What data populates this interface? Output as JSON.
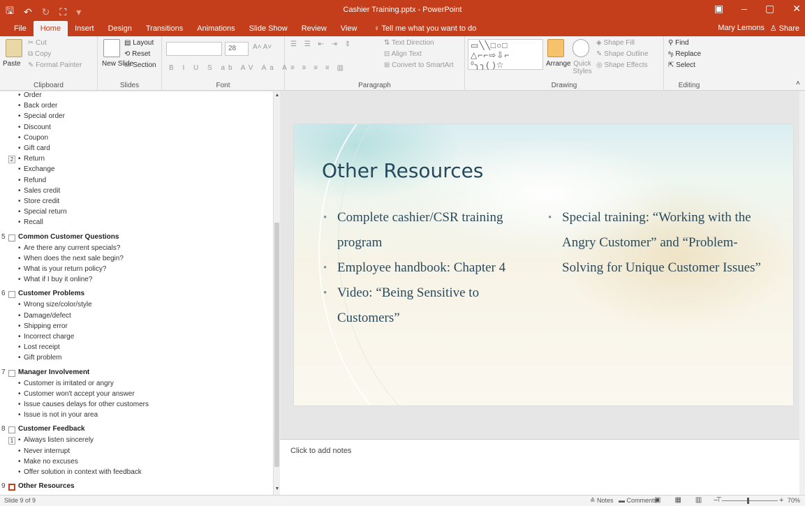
{
  "app": {
    "title": "Cashier Training.pptx - PowerPoint",
    "accent": "#c43e1c",
    "user": "Mary Lemons",
    "share": "Share"
  },
  "tabs": [
    "File",
    "Home",
    "Insert",
    "Design",
    "Transitions",
    "Animations",
    "Slide Show",
    "Review",
    "View",
    "Tell me what you want to do"
  ],
  "active_tab": "Home",
  "ribbon": {
    "clipboard": {
      "label": "Clipboard",
      "paste": "Paste",
      "cut": "Cut",
      "copy": "Copy",
      "format_painter": "Format Painter"
    },
    "slides": {
      "label": "Slides",
      "new_slide": "New Slide",
      "layout": "Layout",
      "reset": "Reset",
      "section": "Section"
    },
    "font": {
      "label": "Font",
      "size": "28"
    },
    "paragraph": {
      "label": "Paragraph",
      "text_direction": "Text Direction",
      "align_text": "Align Text",
      "convert_smartart": "Convert to SmartArt"
    },
    "drawing": {
      "label": "Drawing",
      "arrange": "Arrange",
      "quick_styles": "Quick Styles",
      "shape_fill": "Shape Fill",
      "shape_outline": "Shape Outline",
      "shape_effects": "Shape Effects"
    },
    "editing": {
      "label": "Editing",
      "find": "Find",
      "replace": "Replace",
      "select": "Select"
    }
  },
  "outline": [
    {
      "type": "bullet",
      "text": "Order"
    },
    {
      "type": "bullet",
      "text": "Back order"
    },
    {
      "type": "bullet",
      "text": "Special order"
    },
    {
      "type": "bullet",
      "text": "Discount"
    },
    {
      "type": "bullet",
      "text": "Coupon"
    },
    {
      "type": "bullet",
      "text": "Gift card"
    },
    {
      "type": "bullet",
      "text": "Return",
      "level": "2"
    },
    {
      "type": "bullet",
      "text": "Exchange"
    },
    {
      "type": "bullet",
      "text": "Refund"
    },
    {
      "type": "bullet",
      "text": "Sales credit"
    },
    {
      "type": "bullet",
      "text": "Store credit"
    },
    {
      "type": "bullet",
      "text": "Special return"
    },
    {
      "type": "bullet",
      "text": "Recall"
    },
    {
      "type": "title",
      "num": "5",
      "text": "Common Customer Questions"
    },
    {
      "type": "bullet",
      "text": "Are there any current specials?"
    },
    {
      "type": "bullet",
      "text": "When does the next sale begin?"
    },
    {
      "type": "bullet",
      "text": "What is your return policy?"
    },
    {
      "type": "bullet",
      "text": "What if I buy it online?"
    },
    {
      "type": "title",
      "num": "6",
      "text": "Customer Problems"
    },
    {
      "type": "bullet",
      "text": "Wrong size/color/style"
    },
    {
      "type": "bullet",
      "text": "Damage/defect"
    },
    {
      "type": "bullet",
      "text": "Shipping error"
    },
    {
      "type": "bullet",
      "text": "Incorrect charge"
    },
    {
      "type": "bullet",
      "text": "Lost receipt"
    },
    {
      "type": "bullet",
      "text": "Gift problem"
    },
    {
      "type": "title",
      "num": "7",
      "text": "Manager Involvement"
    },
    {
      "type": "bullet",
      "text": "Customer is irritated or angry"
    },
    {
      "type": "bullet",
      "text": "Customer won't accept your answer"
    },
    {
      "type": "bullet",
      "text": "Issue causes delays for other customers"
    },
    {
      "type": "bullet",
      "text": "Issue is not in your area"
    },
    {
      "type": "title",
      "num": "8",
      "text": "Customer Feedback"
    },
    {
      "type": "bullet",
      "text": "Always listen sincerely",
      "level": "1"
    },
    {
      "type": "bullet",
      "text": "Never interrupt"
    },
    {
      "type": "bullet",
      "text": "Make no excuses"
    },
    {
      "type": "bullet",
      "text": "Offer solution in context with feedback"
    },
    {
      "type": "title",
      "num": "9",
      "text": "Other Resources",
      "current": true
    }
  ],
  "slide": {
    "title": "Other Resources",
    "left_bullets": [
      "Complete cashier/CSR training program",
      "Employee handbook: Chapter 4",
      "Video: “Being Sensitive to Customers”"
    ],
    "right_bullets": [
      "Special training: “Working with the Angry Customer” and “Problem-Solving for Unique Customer Issues”"
    ]
  },
  "notes_placeholder": "Click to add notes",
  "status": {
    "slide_counter": "Slide 9 of 9",
    "notes": "Notes",
    "comments": "Comments",
    "zoom": "70%"
  }
}
